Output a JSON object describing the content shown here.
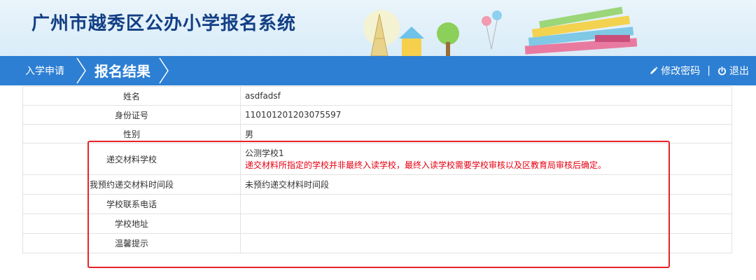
{
  "header": {
    "title": "广州市越秀区公办小学报名系统"
  },
  "nav": {
    "breadcrumb_home": "入学申请",
    "breadcrumb_current": "报名结果",
    "change_password": "修改密码",
    "divider": "|",
    "logout": "退出"
  },
  "table": {
    "rows": [
      {
        "label": "姓名",
        "value": "asdfadsf"
      },
      {
        "label": "身份证号",
        "value": "110101201203075597"
      },
      {
        "label": "性别",
        "value": "男"
      },
      {
        "label": "递交材料学校",
        "value": "公测学校1",
        "note": "递交材料所指定的学校并非最终入读学校，最终入读学校需要学校审核以及区教育局审核后确定。"
      },
      {
        "label": "我预约递交材料时间段",
        "value": "未预约递交材料时间段"
      },
      {
        "label": "学校联系电话",
        "value": ""
      },
      {
        "label": "学校地址",
        "value": ""
      },
      {
        "label": "温馨提示",
        "value": ""
      }
    ]
  },
  "colors": {
    "navbar": "#2d7fd3",
    "title": "#123f84",
    "note": "#e60012",
    "highlight": "#e6232a"
  },
  "icons": {
    "edit": "pencil-icon",
    "logout": "power-icon",
    "breadcrumb_separator": "chevron-right-icon"
  }
}
